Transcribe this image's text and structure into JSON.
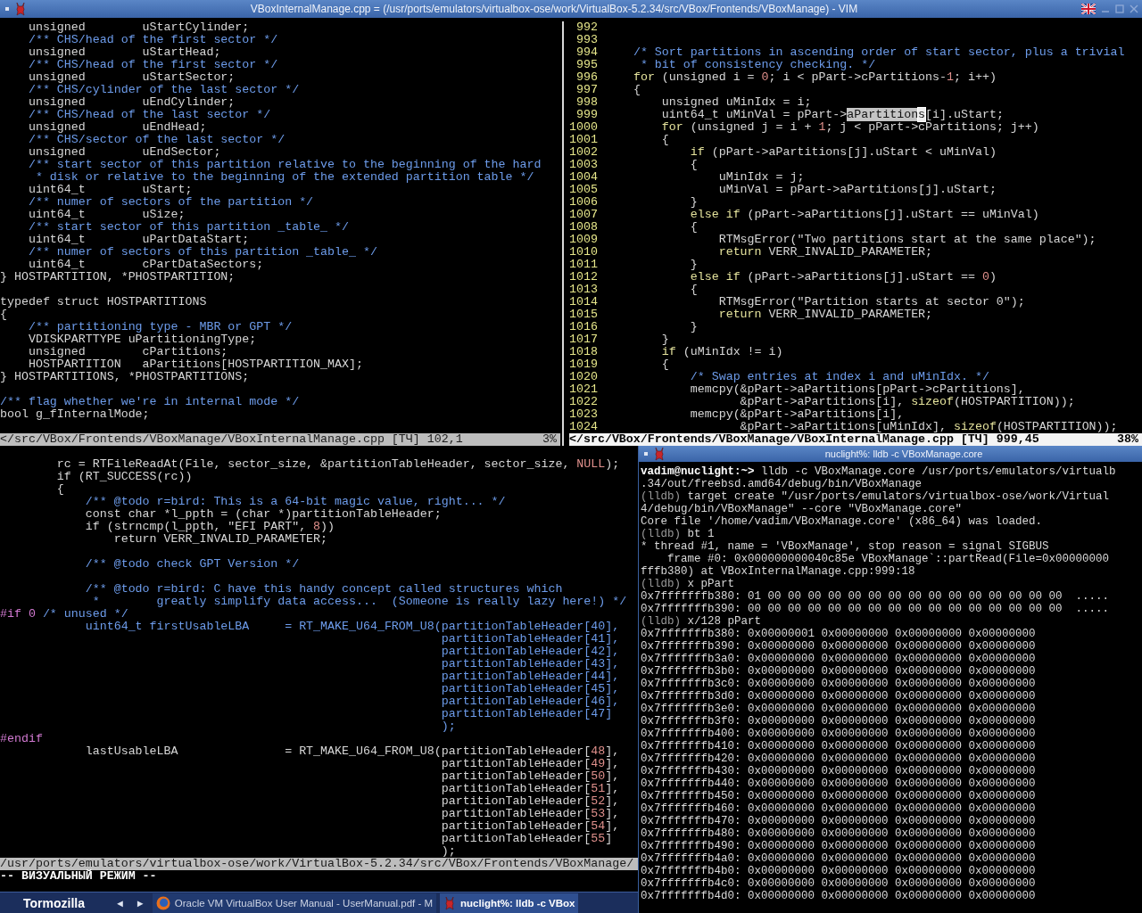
{
  "window": {
    "title": "VBoxInternalManage.cpp = (/usr/ports/emulators/virtualbox-ose/work/VirtualBox-5.2.34/src/VBox/Frontends/VBoxManage) - VIM"
  },
  "top_left_pane": {
    "lines": [
      {
        "kind": "code",
        "text": "    unsigned        uStartCylinder;"
      },
      {
        "kind": "comment",
        "text": "    /** CHS/head of the first sector */"
      },
      {
        "kind": "code",
        "text": "    unsigned        uStartHead;"
      },
      {
        "kind": "comment",
        "text": "    /** CHS/head of the first sector */"
      },
      {
        "kind": "code",
        "text": "    unsigned        uStartSector;"
      },
      {
        "kind": "comment",
        "text": "    /** CHS/cylinder of the last sector */"
      },
      {
        "kind": "code",
        "text": "    unsigned        uEndCylinder;"
      },
      {
        "kind": "comment",
        "text": "    /** CHS/head of the last sector */"
      },
      {
        "kind": "code",
        "text": "    unsigned        uEndHead;"
      },
      {
        "kind": "comment",
        "text": "    /** CHS/sector of the last sector */"
      },
      {
        "kind": "code",
        "text": "    unsigned        uEndSector;"
      },
      {
        "kind": "comment",
        "text": "    /** start sector of this partition relative to the beginning of the hard"
      },
      {
        "kind": "comment",
        "text": "     * disk or relative to the beginning of the extended partition table */"
      },
      {
        "kind": "code",
        "text": "    uint64_t        uStart;"
      },
      {
        "kind": "comment",
        "text": "    /** numer of sectors of the partition */"
      },
      {
        "kind": "code",
        "text": "    uint64_t        uSize;"
      },
      {
        "kind": "comment",
        "text": "    /** start sector of this partition _table_ */"
      },
      {
        "kind": "code",
        "text": "    uint64_t        uPartDataStart;"
      },
      {
        "kind": "comment",
        "text": "    /** numer of sectors of this partition _table_ */"
      },
      {
        "kind": "code",
        "text": "    uint64_t        cPartDataSectors;"
      },
      {
        "kind": "code",
        "text": "} HOSTPARTITION, *PHOSTPARTITION;"
      },
      {
        "kind": "blank"
      },
      {
        "kind": "code",
        "text": "typedef struct HOSTPARTITIONS"
      },
      {
        "kind": "code",
        "text": "{"
      },
      {
        "kind": "comment",
        "text": "    /** partitioning type - MBR or GPT */"
      },
      {
        "kind": "code",
        "text": "    VDISKPARTTYPE uPartitioningType;"
      },
      {
        "kind": "code",
        "text": "    unsigned        cPartitions;"
      },
      {
        "kind": "code",
        "text": "    HOSTPARTITION   aPartitions[HOSTPARTITION_MAX];"
      },
      {
        "kind": "code",
        "text": "} HOSTPARTITIONS, *PHOSTPARTITIONS;"
      },
      {
        "kind": "blank"
      },
      {
        "kind": "comment",
        "text": "/** flag whether we're in internal mode */"
      },
      {
        "kind": "code",
        "text": "bool g_fInternalMode;"
      },
      {
        "kind": "blank"
      }
    ],
    "status": {
      "text": "</src/VBox/Frontends/VBoxManage/VBoxInternalManage.cpp [ТЧ] 102,1",
      "percent": "3%",
      "selected": false
    }
  },
  "top_right_pane": {
    "lines": [
      {
        "number": "992",
        "kind": "blank"
      },
      {
        "number": "993",
        "kind": "blank"
      },
      {
        "number": "994",
        "kind": "comment",
        "text": "    /* Sort partitions in ascending order of start sector, plus a trivial"
      },
      {
        "number": "995",
        "kind": "comment",
        "text": "     * bit of consistency checking. */"
      },
      {
        "number": "996",
        "kind": "mixed",
        "parts": [
          {
            "kind": "keyword",
            "text": "    for"
          },
          {
            "kind": "code",
            "text": " (unsigned i = "
          },
          {
            "kind": "number",
            "text": "0"
          },
          {
            "kind": "code",
            "text": "; i < pPart->cPartitions-"
          },
          {
            "kind": "number",
            "text": "1"
          },
          {
            "kind": "code",
            "text": "; i++)"
          }
        ]
      },
      {
        "number": "997",
        "kind": "code",
        "text": "    {"
      },
      {
        "number": "998",
        "kind": "code",
        "text": "        unsigned uMinIdx = i;"
      },
      {
        "number": "999",
        "kind": "mixed",
        "parts": [
          {
            "kind": "code",
            "text": "        uint64_t uMinVal = pPart->"
          },
          {
            "kind": "selection",
            "text": "aPartition"
          },
          {
            "kind": "cursor",
            "text": "s"
          },
          {
            "kind": "code",
            "text": "[i].uStart;"
          }
        ]
      },
      {
        "number": "1000",
        "kind": "mixed",
        "parts": [
          {
            "kind": "keyword",
            "text": "        for"
          },
          {
            "kind": "code",
            "text": " (unsigned j = i + "
          },
          {
            "kind": "number",
            "text": "1"
          },
          {
            "kind": "code",
            "text": "; j < pPart->cPartitions; j++)"
          }
        ]
      },
      {
        "number": "1001",
        "kind": "code",
        "text": "        {"
      },
      {
        "number": "1002",
        "kind": "mixed",
        "parts": [
          {
            "kind": "keyword",
            "text": "            if"
          },
          {
            "kind": "code",
            "text": " (pPart->aPartitions[j].uStart < uMinVal)"
          }
        ]
      },
      {
        "number": "1003",
        "kind": "code",
        "text": "            {"
      },
      {
        "number": "1004",
        "kind": "code",
        "text": "                uMinIdx = j;"
      },
      {
        "number": "1005",
        "kind": "code",
        "text": "                uMinVal = pPart->aPartitions[j].uStart;"
      },
      {
        "number": "1006",
        "kind": "code",
        "text": "            }"
      },
      {
        "number": "1007",
        "kind": "mixed",
        "parts": [
          {
            "kind": "keyword",
            "text": "            else if"
          },
          {
            "kind": "code",
            "text": " (pPart->aPartitions[j].uStart == uMinVal)"
          }
        ]
      },
      {
        "number": "1008",
        "kind": "code",
        "text": "            {"
      },
      {
        "number": "1009",
        "kind": "code",
        "text": "                RTMsgError(\"Two partitions start at the same place\");"
      },
      {
        "number": "1010",
        "kind": "mixed",
        "parts": [
          {
            "kind": "keyword",
            "text": "                return"
          },
          {
            "kind": "code",
            "text": " VERR_INVALID_PARAMETER;"
          }
        ]
      },
      {
        "number": "1011",
        "kind": "code",
        "text": "            }"
      },
      {
        "number": "1012",
        "kind": "mixed",
        "parts": [
          {
            "kind": "keyword",
            "text": "            else if"
          },
          {
            "kind": "code",
            "text": " (pPart->aPartitions[j].uStart == "
          },
          {
            "kind": "number",
            "text": "0"
          },
          {
            "kind": "code",
            "text": ")"
          }
        ]
      },
      {
        "number": "1013",
        "kind": "code",
        "text": "            {"
      },
      {
        "number": "1014",
        "kind": "code",
        "text": "                RTMsgError(\"Partition starts at sector 0\");"
      },
      {
        "number": "1015",
        "kind": "mixed",
        "parts": [
          {
            "kind": "keyword",
            "text": "                return"
          },
          {
            "kind": "code",
            "text": " VERR_INVALID_PARAMETER;"
          }
        ]
      },
      {
        "number": "1016",
        "kind": "code",
        "text": "            }"
      },
      {
        "number": "1017",
        "kind": "code",
        "text": "        }"
      },
      {
        "number": "1018",
        "kind": "mixed",
        "parts": [
          {
            "kind": "keyword",
            "text": "        if"
          },
          {
            "kind": "code",
            "text": " (uMinIdx != i)"
          }
        ]
      },
      {
        "number": "1019",
        "kind": "code",
        "text": "        {"
      },
      {
        "number": "1020",
        "kind": "comment",
        "text": "            /* Swap entries at index i and uMinIdx. */"
      },
      {
        "number": "1021",
        "kind": "code",
        "text": "            memcpy(&pPart->aPartitions[pPart->cPartitions],"
      },
      {
        "number": "1022",
        "kind": "mixed",
        "parts": [
          {
            "kind": "code",
            "text": "                   &pPart->aPartitions[i], "
          },
          {
            "kind": "keyword",
            "text": "sizeof"
          },
          {
            "kind": "code",
            "text": "(HOSTPARTITION));"
          }
        ]
      },
      {
        "number": "1023",
        "kind": "code",
        "text": "            memcpy(&pPart->aPartitions[i],"
      },
      {
        "number": "1024",
        "kind": "mixed",
        "parts": [
          {
            "kind": "code",
            "text": "                   &pPart->aPartitions[uMinIdx], "
          },
          {
            "kind": "keyword",
            "text": "sizeof"
          },
          {
            "kind": "code",
            "text": "(HOSTPARTITION));"
          }
        ]
      }
    ],
    "status": {
      "text": "</src/VBox/Frontends/VBoxManage/VBoxInternalManage.cpp [ТЧ] 999,45",
      "percent": "38%",
      "selected": true
    }
  },
  "bottom_pane": {
    "lines": [
      {
        "kind": "blank"
      },
      {
        "kind": "mixed",
        "parts": [
          {
            "kind": "code",
            "text": "        rc = RTFileReadAt(File, sector_size, &partitionTableHeader, sector_size, "
          },
          {
            "kind": "number",
            "text": "NULL"
          },
          {
            "kind": "code",
            "text": ");"
          }
        ]
      },
      {
        "kind": "code",
        "text": "        if (RT_SUCCESS(rc))"
      },
      {
        "kind": "code",
        "text": "        {"
      },
      {
        "kind": "comment",
        "text": "            /** @todo r=bird: This is a 64-bit magic value, right... */"
      },
      {
        "kind": "code",
        "text": "            const char *l_ppth = (char *)partitionTableHeader;"
      },
      {
        "kind": "mixed",
        "parts": [
          {
            "kind": "code",
            "text": "            if (strncmp(l_ppth, \"EFI PART\", "
          },
          {
            "kind": "number",
            "text": "8"
          },
          {
            "kind": "code",
            "text": "))"
          }
        ]
      },
      {
        "kind": "code",
        "text": "                return VERR_INVALID_PARAMETER;"
      },
      {
        "kind": "blank"
      },
      {
        "kind": "comment",
        "text": "            /** @todo check GPT Version */"
      },
      {
        "kind": "blank"
      },
      {
        "kind": "comment",
        "text": "            /** @todo r=bird: C have this handy concept called structures which"
      },
      {
        "kind": "comment",
        "text": "             *        greatly simplify data access...  (Someone is really lazy here!) */"
      },
      {
        "kind": "mixed",
        "parts": [
          {
            "kind": "preproc",
            "text": "#if 0"
          },
          {
            "kind": "comment",
            "text": " /* unused */"
          }
        ]
      },
      {
        "kind": "comment",
        "text": "            uint64_t firstUsableLBA     = RT_MAKE_U64_FROM_U8(partitionTableHeader[40],"
      },
      {
        "kind": "comment",
        "text": "                                                              partitionTableHeader[41],"
      },
      {
        "kind": "comment",
        "text": "                                                              partitionTableHeader[42],"
      },
      {
        "kind": "comment",
        "text": "                                                              partitionTableHeader[43],"
      },
      {
        "kind": "comment",
        "text": "                                                              partitionTableHeader[44],"
      },
      {
        "kind": "comment",
        "text": "                                                              partitionTableHeader[45],"
      },
      {
        "kind": "comment",
        "text": "                                                              partitionTableHeader[46],"
      },
      {
        "kind": "comment",
        "text": "                                                              partitionTableHeader[47]"
      },
      {
        "kind": "comment",
        "text": "                                                              );"
      },
      {
        "kind": "preproc",
        "text": "#endif"
      },
      {
        "kind": "mixed",
        "parts": [
          {
            "kind": "code",
            "text": "            lastUsableLBA               = RT_MAKE_U64_FROM_U8(partitionTableHeader["
          },
          {
            "kind": "number",
            "text": "48"
          },
          {
            "kind": "code",
            "text": "],"
          }
        ]
      },
      {
        "kind": "mixed",
        "parts": [
          {
            "kind": "code",
            "text": "                                                              partitionTableHeader["
          },
          {
            "kind": "number",
            "text": "49"
          },
          {
            "kind": "code",
            "text": "],"
          }
        ]
      },
      {
        "kind": "mixed",
        "parts": [
          {
            "kind": "code",
            "text": "                                                              partitionTableHeader["
          },
          {
            "kind": "number",
            "text": "50"
          },
          {
            "kind": "code",
            "text": "],"
          }
        ]
      },
      {
        "kind": "mixed",
        "parts": [
          {
            "kind": "code",
            "text": "                                                              partitionTableHeader["
          },
          {
            "kind": "number",
            "text": "51"
          },
          {
            "kind": "code",
            "text": "],"
          }
        ]
      },
      {
        "kind": "mixed",
        "parts": [
          {
            "kind": "code",
            "text": "                                                              partitionTableHeader["
          },
          {
            "kind": "number",
            "text": "52"
          },
          {
            "kind": "code",
            "text": "],"
          }
        ]
      },
      {
        "kind": "mixed",
        "parts": [
          {
            "kind": "code",
            "text": "                                                              partitionTableHeader["
          },
          {
            "kind": "number",
            "text": "53"
          },
          {
            "kind": "code",
            "text": "],"
          }
        ]
      },
      {
        "kind": "mixed",
        "parts": [
          {
            "kind": "code",
            "text": "                                                              partitionTableHeader["
          },
          {
            "kind": "number",
            "text": "54"
          },
          {
            "kind": "code",
            "text": "],"
          }
        ]
      },
      {
        "kind": "mixed",
        "parts": [
          {
            "kind": "code",
            "text": "                                                              partitionTableHeader["
          },
          {
            "kind": "number",
            "text": "55"
          },
          {
            "kind": "code",
            "text": "]"
          }
        ]
      },
      {
        "kind": "code",
        "text": "                                                              );"
      }
    ],
    "status": {
      "text": "/usr/ports/emulators/virtualbox-ose/work/VirtualBox-5.2.34/src/VBox/Frontends/VBoxManage/",
      "selected": false
    }
  },
  "mode_line": "-- ВИЗУАЛЬНЫЙ РЕЖИМ --",
  "terminal": {
    "title": "nuclight%: lldb -c VBoxManage.core",
    "lines": [
      {
        "kind": "shell",
        "prompt": "vadim@nuclight:~>",
        "text": "lldb -c VBoxManage.core /usr/ports/emulators/virtualb"
      },
      {
        "kind": "output",
        "text": ".34/out/freebsd.amd64/debug/bin/VBoxManage"
      },
      {
        "kind": "lldb",
        "prompt": "(lldb)",
        "text": "target create \"/usr/ports/emulators/virtualbox-ose/work/Virtual"
      },
      {
        "kind": "output",
        "text": "4/debug/bin/VBoxManage\" --core \"VBoxManage.core\""
      },
      {
        "kind": "output",
        "text": "Core file '/home/vadim/VBoxManage.core' (x86_64) was loaded."
      },
      {
        "kind": "lldb",
        "prompt": "(lldb)",
        "text": "bt 1"
      },
      {
        "kind": "output",
        "text": "* thread #1, name = 'VBoxManage', stop reason = signal SIGBUS"
      },
      {
        "kind": "output",
        "text": "    frame #0: 0x000000000040c85e VBoxManage`::partRead(File=0x00000000"
      },
      {
        "kind": "output",
        "text": "fffb380) at VBoxInternalManage.cpp:999:18"
      },
      {
        "kind": "lldb",
        "prompt": "(lldb)",
        "text": "x pPart"
      },
      {
        "kind": "output",
        "text": "0x7fffffffb380: 01 00 00 00 00 00 00 00 00 00 00 00 00 00 00 00  ....."
      },
      {
        "kind": "output",
        "text": "0x7fffffffb390: 00 00 00 00 00 00 00 00 00 00 00 00 00 00 00 00  ....."
      },
      {
        "kind": "lldb",
        "prompt": "(lldb)",
        "text": "x/128 pPart"
      },
      {
        "kind": "output",
        "text": "0x7fffffffb380: 0x00000001 0x00000000 0x00000000 0x00000000"
      },
      {
        "kind": "output",
        "text": "0x7fffffffb390: 0x00000000 0x00000000 0x00000000 0x00000000"
      },
      {
        "kind": "output",
        "text": "0x7fffffffb3a0: 0x00000000 0x00000000 0x00000000 0x00000000"
      },
      {
        "kind": "output",
        "text": "0x7fffffffb3b0: 0x00000000 0x00000000 0x00000000 0x00000000"
      },
      {
        "kind": "output",
        "text": "0x7fffffffb3c0: 0x00000000 0x00000000 0x00000000 0x00000000"
      },
      {
        "kind": "output",
        "text": "0x7fffffffb3d0: 0x00000000 0x00000000 0x00000000 0x00000000"
      },
      {
        "kind": "output",
        "text": "0x7fffffffb3e0: 0x00000000 0x00000000 0x00000000 0x00000000"
      },
      {
        "kind": "output",
        "text": "0x7fffffffb3f0: 0x00000000 0x00000000 0x00000000 0x00000000"
      },
      {
        "kind": "output",
        "text": "0x7fffffffb400: 0x00000000 0x00000000 0x00000000 0x00000000"
      },
      {
        "kind": "output",
        "text": "0x7fffffffb410: 0x00000000 0x00000000 0x00000000 0x00000000"
      },
      {
        "kind": "output",
        "text": "0x7fffffffb420: 0x00000000 0x00000000 0x00000000 0x00000000"
      },
      {
        "kind": "output",
        "text": "0x7fffffffb430: 0x00000000 0x00000000 0x00000000 0x00000000"
      },
      {
        "kind": "output",
        "text": "0x7fffffffb440: 0x00000000 0x00000000 0x00000000 0x00000000"
      },
      {
        "kind": "output",
        "text": "0x7fffffffb450: 0x00000000 0x00000000 0x00000000 0x00000000"
      },
      {
        "kind": "output",
        "text": "0x7fffffffb460: 0x00000000 0x00000000 0x00000000 0x00000000"
      },
      {
        "kind": "output",
        "text": "0x7fffffffb470: 0x00000000 0x00000000 0x00000000 0x00000000"
      },
      {
        "kind": "output",
        "text": "0x7fffffffb480: 0x00000000 0x00000000 0x00000000 0x00000000"
      },
      {
        "kind": "output",
        "text": "0x7fffffffb490: 0x00000000 0x00000000 0x00000000 0x00000000"
      },
      {
        "kind": "output",
        "text": "0x7fffffffb4a0: 0x00000000 0x00000000 0x00000000 0x00000000"
      },
      {
        "kind": "output",
        "text": "0x7fffffffb4b0: 0x00000000 0x00000000 0x00000000 0x00000000"
      },
      {
        "kind": "output",
        "text": "0x7fffffffb4c0: 0x00000000 0x00000000 0x00000000 0x00000000"
      },
      {
        "kind": "output",
        "text": "0x7fffffffb4d0: 0x00000000 0x00000000 0x00000000 0x00000000"
      }
    ]
  },
  "taskbar": {
    "menu_label": "Tormozilla",
    "scroll_left": "◄",
    "scroll_right": "►",
    "tasks": [
      {
        "kind": "browser",
        "label": "Oracle VM VirtualBox User Manual - UserManual.pdf - M",
        "selected": false
      },
      {
        "kind": "terminal",
        "label": "nuclight%: lldb -c VBox",
        "selected": true
      }
    ]
  }
}
